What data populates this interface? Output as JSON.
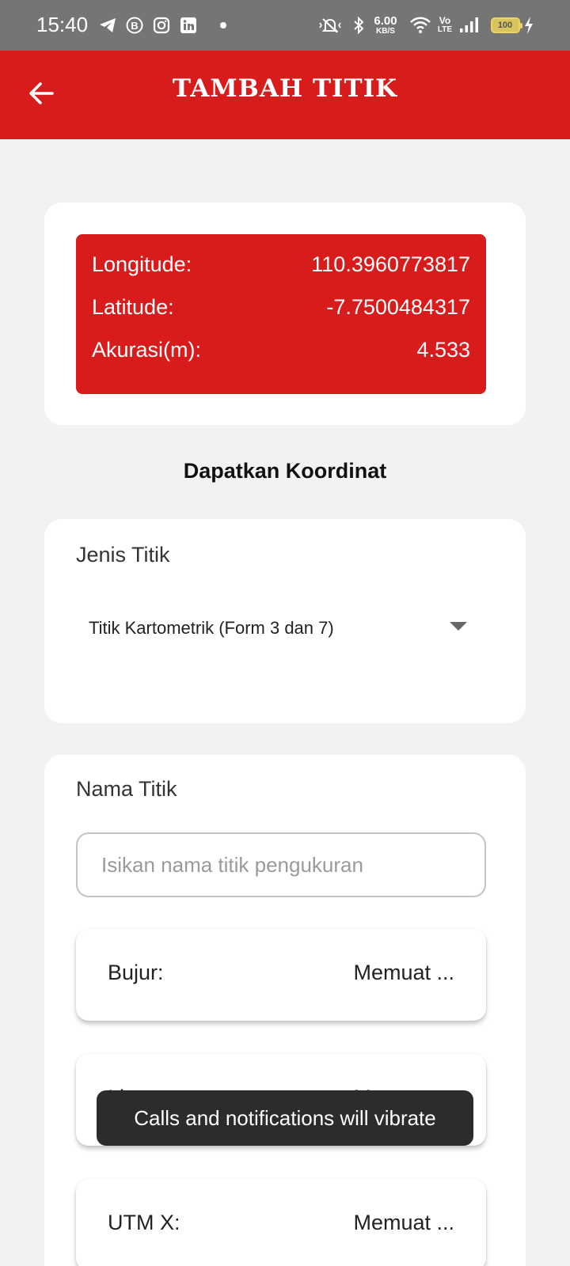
{
  "status_bar": {
    "time": "15:40",
    "network_speed": "6.00",
    "network_speed_unit": "KB/S",
    "volte_line1": "Vo",
    "volte_line2": "LTE",
    "battery_level": "100",
    "icons": [
      "telegram-icon",
      "b-icon",
      "instagram-icon",
      "linkedin-icon",
      "dot-icon",
      "vibrate-icon",
      "bluetooth-icon",
      "wifi-icon",
      "signal-icon",
      "battery-icon",
      "charging-icon"
    ]
  },
  "app_bar": {
    "title": "TAMBAH TITIK",
    "accent_color": "#d81b1b"
  },
  "coordinates": {
    "longitude_label": "Longitude:",
    "longitude_value": "110.3960773817",
    "latitude_label": "Latitude:",
    "latitude_value": "-7.7500484317",
    "accuracy_label": "Akurasi(m):",
    "accuracy_value": "4.533"
  },
  "get_coordinates_label": "Dapatkan Koordinat",
  "jenis_titik": {
    "label": "Jenis Titik",
    "selected": "Titik Kartometrik (Form 3 dan 7)"
  },
  "nama_titik": {
    "label": "Nama Titik",
    "placeholder": "Isikan nama titik pengukuran",
    "value": ""
  },
  "fields": [
    {
      "label": "Bujur:",
      "value": "Memuat ..."
    },
    {
      "label": "Lintang:",
      "value": "Memuat ..."
    },
    {
      "label": "UTM X:",
      "value": "Memuat ..."
    }
  ],
  "toast": "Calls and notifications will vibrate"
}
